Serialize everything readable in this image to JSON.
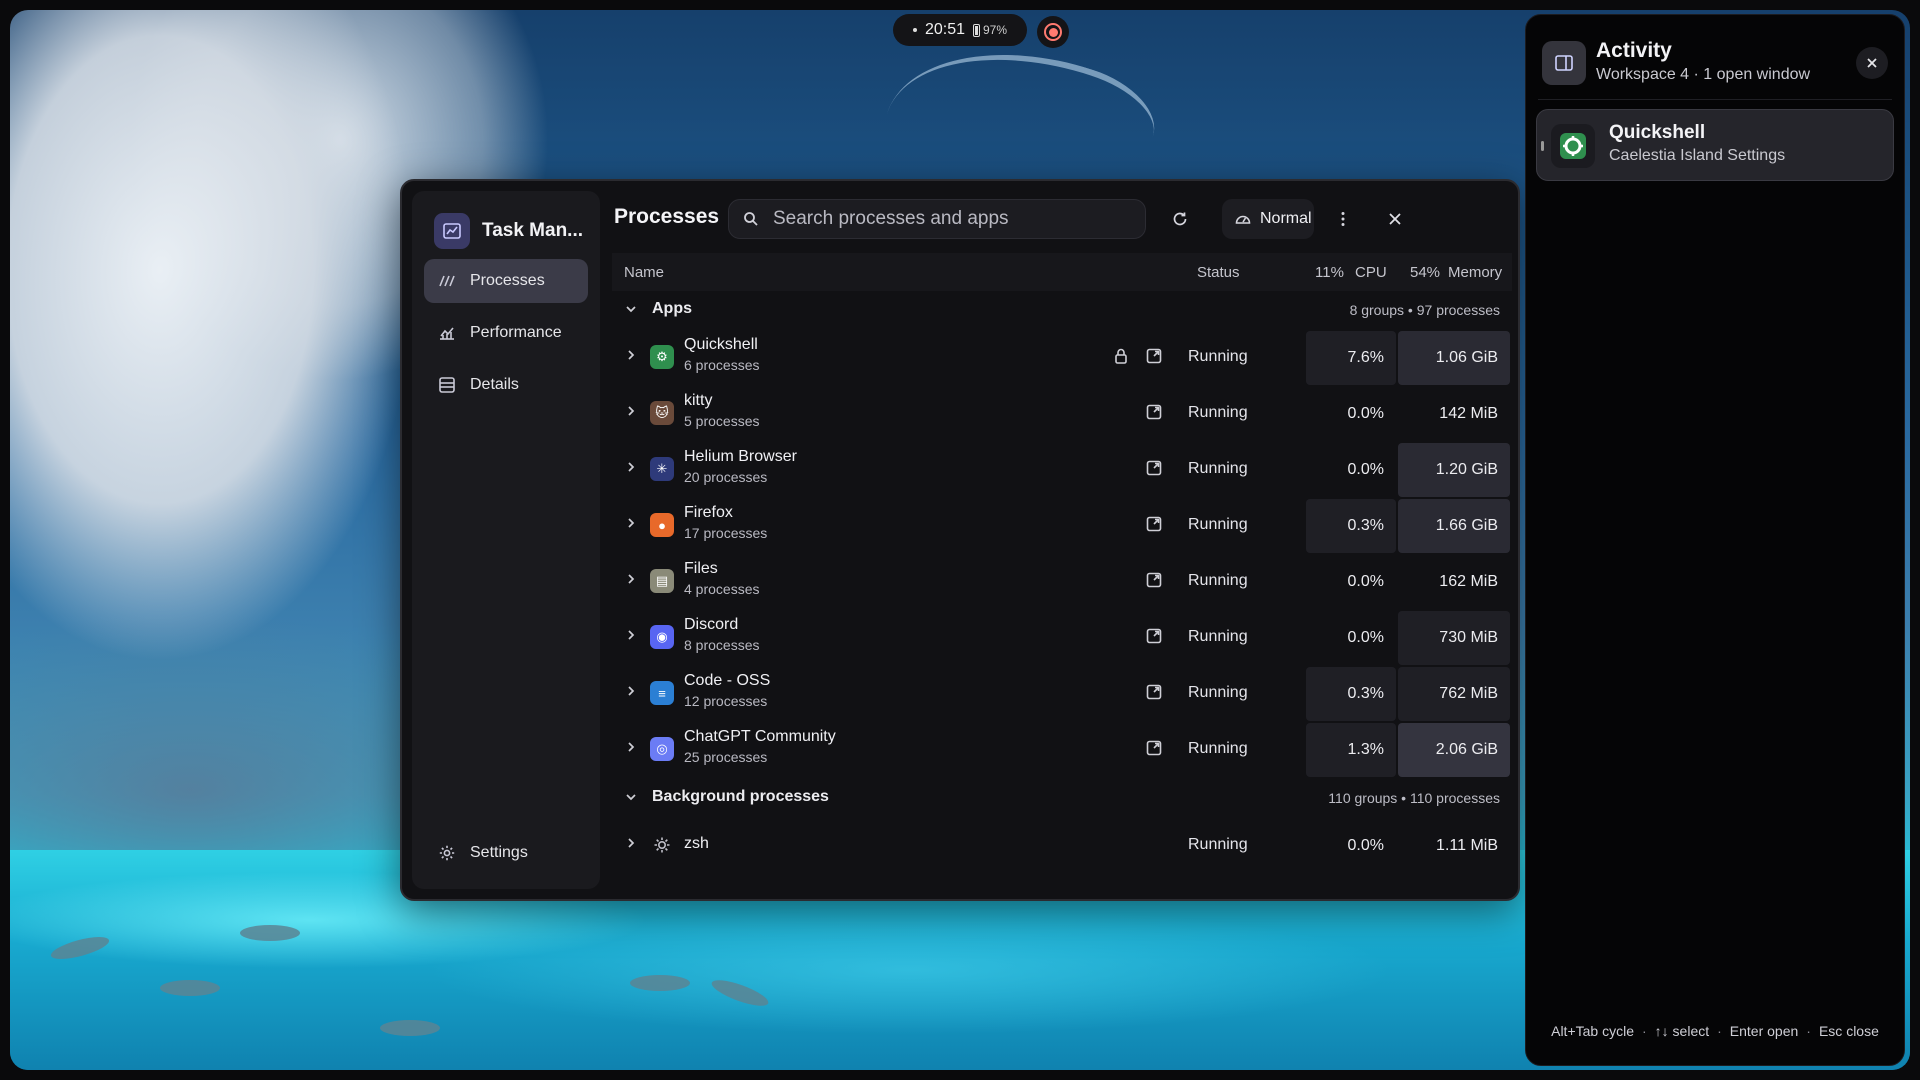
{
  "topbar": {
    "time": "20:51",
    "battery": "97%"
  },
  "task_manager": {
    "app_title": "Task Man...",
    "nav": [
      {
        "label": "Processes",
        "icon": "processes-icon",
        "active": true
      },
      {
        "label": "Performance",
        "icon": "performance-icon",
        "active": false
      },
      {
        "label": "Details",
        "icon": "details-icon",
        "active": false
      }
    ],
    "settings_label": "Settings",
    "page_title": "Processes",
    "search_placeholder": "Search processes and apps",
    "mode_label": "Normal",
    "columns": {
      "name": "Name",
      "status": "Status",
      "cpu_total": "11%",
      "cpu": "CPU",
      "mem_total": "54%",
      "memory": "Memory"
    },
    "apps_group": {
      "label": "Apps",
      "count": "8 groups • 97 processes"
    },
    "apps": [
      {
        "name": "Quickshell",
        "sub": "6 processes",
        "status": "Running",
        "cpu": "7.6%",
        "mem": "1.06 GiB",
        "locked": true,
        "icon": "quickshell-icon",
        "icon_color": "#2f8f4e"
      },
      {
        "name": "kitty",
        "sub": "5 processes",
        "status": "Running",
        "cpu": "0.0%",
        "mem": "142 MiB",
        "locked": false,
        "icon": "kitty-icon",
        "icon_color": "#6a4a3a"
      },
      {
        "name": "Helium Browser",
        "sub": "20 processes",
        "status": "Running",
        "cpu": "0.0%",
        "mem": "1.20 GiB",
        "locked": false,
        "icon": "helium-icon",
        "icon_color": "#2e3a7a"
      },
      {
        "name": "Firefox",
        "sub": "17 processes",
        "status": "Running",
        "cpu": "0.3%",
        "mem": "1.66 GiB",
        "locked": false,
        "icon": "firefox-icon",
        "icon_color": "#e8692a"
      },
      {
        "name": "Files",
        "sub": "4 processes",
        "status": "Running",
        "cpu": "0.0%",
        "mem": "162 MiB",
        "locked": false,
        "icon": "files-icon",
        "icon_color": "#8a8a78"
      },
      {
        "name": "Discord",
        "sub": "8 processes",
        "status": "Running",
        "cpu": "0.0%",
        "mem": "730 MiB",
        "locked": false,
        "icon": "discord-icon",
        "icon_color": "#5865f2"
      },
      {
        "name": "Code - OSS",
        "sub": "12 processes",
        "status": "Running",
        "cpu": "0.3%",
        "mem": "762 MiB",
        "locked": false,
        "icon": "code-icon",
        "icon_color": "#2b7fd4"
      },
      {
        "name": "ChatGPT Community",
        "sub": "25 processes",
        "status": "Running",
        "cpu": "1.3%",
        "mem": "2.06 GiB",
        "locked": false,
        "icon": "chatgpt-icon",
        "icon_color": "#6b7cf5"
      }
    ],
    "background_group": {
      "label": "Background processes",
      "count": "110 groups • 110 processes"
    },
    "background": [
      {
        "name": "zsh",
        "status": "Running",
        "cpu": "0.0%",
        "mem": "1.11 MiB",
        "icon": "zsh-icon"
      }
    ]
  },
  "activity": {
    "title": "Activity",
    "subtitle": "Workspace 4 · 1 open window",
    "window": {
      "title": "Quickshell",
      "subtitle": "Caelestia Island Settings"
    },
    "hints": [
      "Alt+Tab cycle",
      "↑↓ select",
      "Enter open",
      "Esc close"
    ]
  }
}
